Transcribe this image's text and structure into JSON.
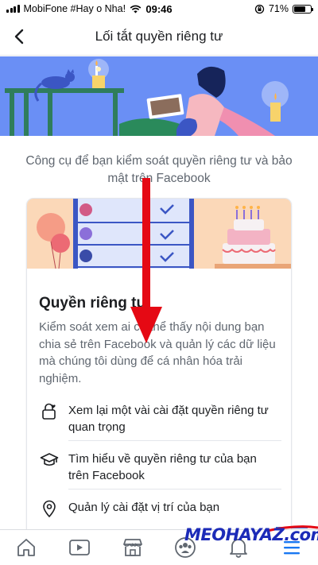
{
  "status_bar": {
    "carrier": "MobiFone #Hay o Nha!",
    "time": "09:46",
    "battery": "71%",
    "battery_level": 0.71
  },
  "nav": {
    "title": "Lối tắt quyền riêng tư",
    "back_icon": "chevron-left-icon"
  },
  "intro": "Công cụ để bạn kiểm soát quyền riêng tư và bảo mật trên Facebook",
  "card": {
    "title": "Quyền riêng tư",
    "description": "Kiểm soát xem ai có thể thấy nội dung bạn chia sẻ trên Facebook và quản lý các dữ liệu mà chúng tôi dùng để cá nhân hóa trải nghiệm.",
    "items": [
      {
        "icon": "lock-heart-icon",
        "label": "Xem lại một vài cài đặt quyền riêng tư quan trọng"
      },
      {
        "icon": "graduation-cap-icon",
        "label": "Tìm hiểu về quyền riêng tư của bạn trên Facebook"
      },
      {
        "icon": "location-pin-icon",
        "label": "Quản lý cài đặt vị trí của bạn"
      }
    ]
  },
  "tab_bar": {
    "tabs": [
      {
        "icon": "home-icon"
      },
      {
        "icon": "watch-video-icon"
      },
      {
        "icon": "marketplace-icon"
      },
      {
        "icon": "groups-icon"
      },
      {
        "icon": "notifications-bell-icon"
      },
      {
        "icon": "menu-icon",
        "active": true
      }
    ]
  },
  "watermark": "MEOHAYAZ.com",
  "colors": {
    "accent": "#1877f2",
    "annotation_arrow": "#e50914",
    "hero_background": "#6a8ff5",
    "card_illustration_background": "#fbd8b8"
  }
}
